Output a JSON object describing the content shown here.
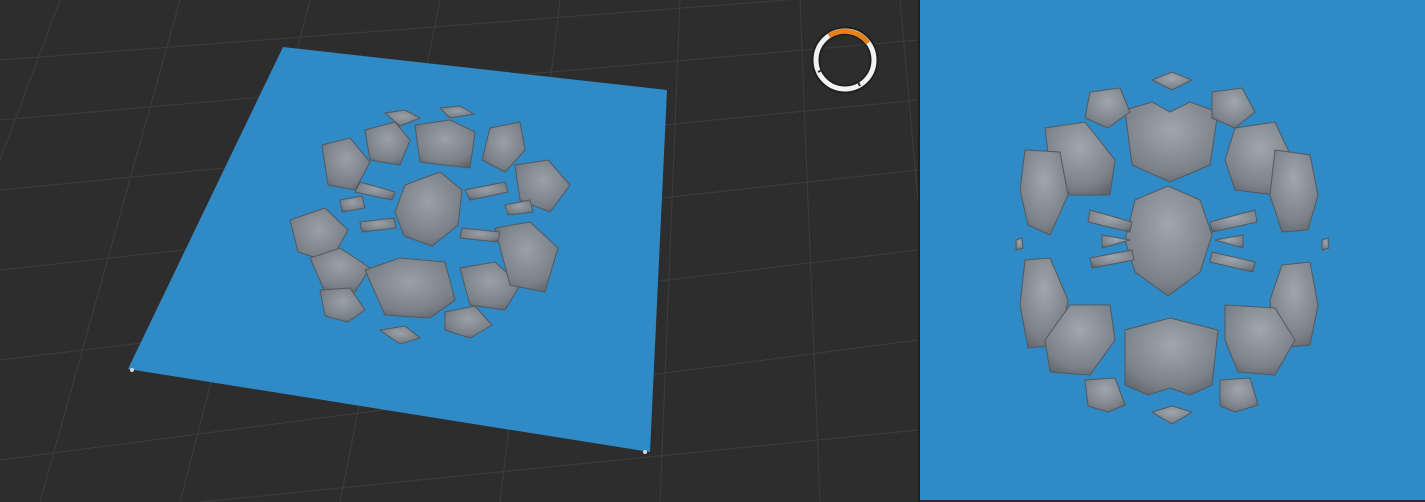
{
  "viewport": {
    "background": "#2d2d2d",
    "grid_color": "#3c3c3c",
    "plane_color": "#2f8ac6",
    "relief_color": "#7c8289",
    "relief_shade": "#5d6268"
  },
  "loading_indicator": {
    "icon": "orbit-ring-icon",
    "accent": "#e8801c",
    "ring": "#f0f0f0"
  },
  "preview": {
    "background": "#2f8ac6",
    "relief_color": "#7c8289"
  }
}
